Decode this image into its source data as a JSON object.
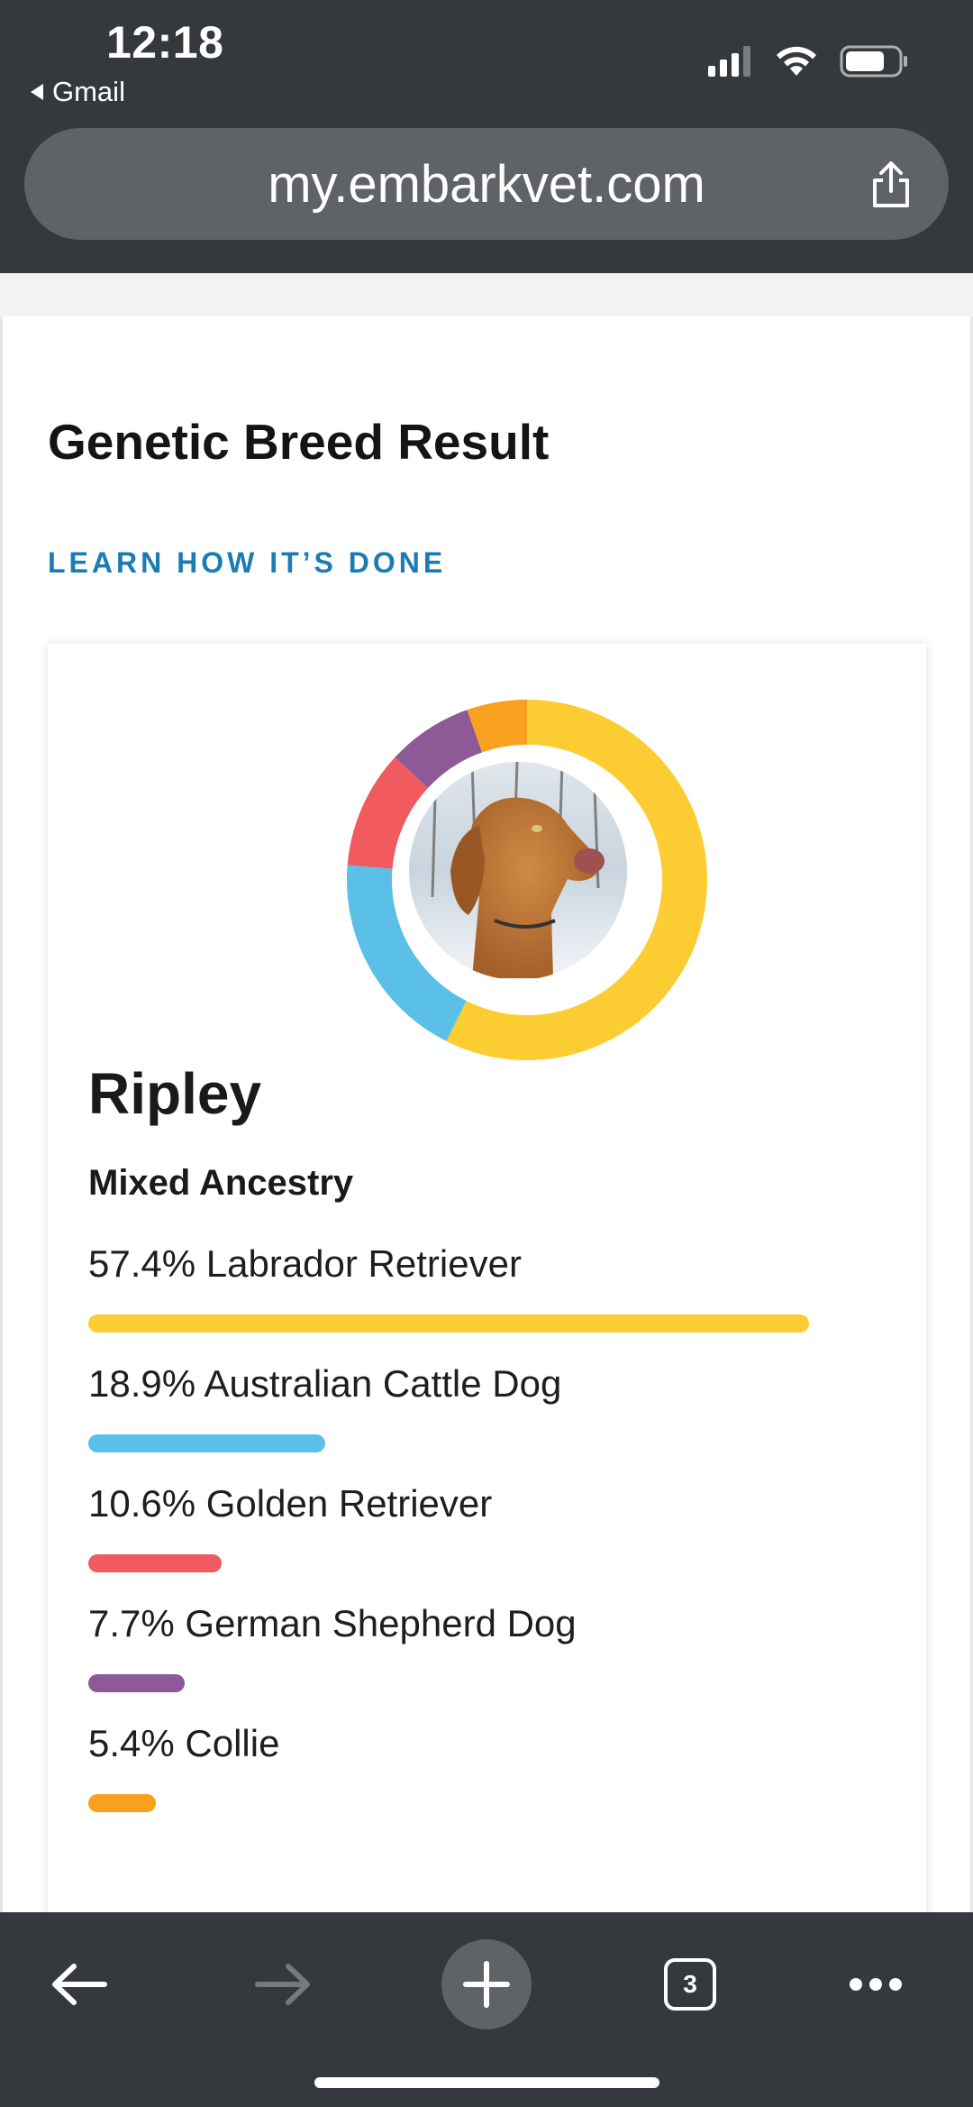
{
  "status_bar": {
    "time": "12:18",
    "back_app_label": "Gmail"
  },
  "browser": {
    "url": "my.embarkvet.com",
    "tabs_count": "3"
  },
  "page": {
    "title": "Genetic Breed Result",
    "learn_link": "LEARN HOW IT’S DONE"
  },
  "dog": {
    "name": "Ripley",
    "ancestry_type": "Mixed Ancestry"
  },
  "breeds": [
    {
      "label": "57.4% Labrador Retriever",
      "percent": 57.4,
      "color": "#fccd32"
    },
    {
      "label": "18.9% Australian Cattle Dog",
      "percent": 18.9,
      "color": "#5bc0e8"
    },
    {
      "label": "10.6% Golden Retriever",
      "percent": 10.6,
      "color": "#f15a5e"
    },
    {
      "label": "7.7% German Shepherd Dog",
      "percent": 7.7,
      "color": "#8d5a97"
    },
    {
      "label": "5.4% Collie",
      "percent": 5.4,
      "color": "#f8a11e"
    }
  ],
  "colors": {
    "chrome_background": "#35383c",
    "url_bar": "#5f6266",
    "link_blue": "#1b7cb3"
  },
  "icons": {
    "back": "arrow-left-icon",
    "forward": "arrow-right-icon",
    "new_tab": "plus-icon",
    "tabs": "tabs-icon",
    "menu": "more-icon",
    "share": "share-icon"
  }
}
